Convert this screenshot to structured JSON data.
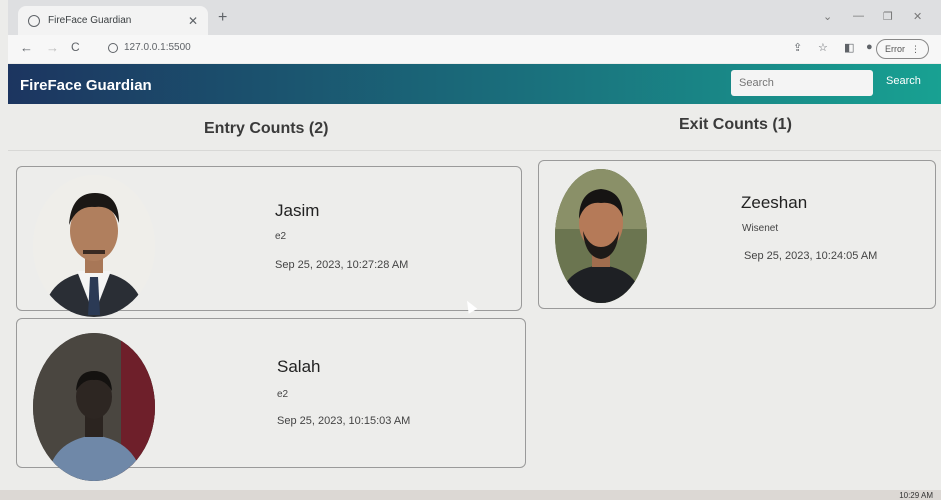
{
  "browser": {
    "tab_title": "FireFace Guardian",
    "tab_close": "✕",
    "new_tab": "+",
    "url": "127.0.0.1:5500",
    "error_label": "Error",
    "min": "⌄",
    "dash": "—",
    "restore": "❐",
    "close": "✕",
    "back": "←",
    "forward": "→",
    "reload": "C"
  },
  "header": {
    "brand": "FireFace Guardian",
    "search_placeholder": "Search",
    "search_button": "Search"
  },
  "entry": {
    "heading": "Entry Counts (2)",
    "items": [
      {
        "name": "Jasim",
        "dept": "e2",
        "time": "Sep 25, 2023, 10:27:28 AM"
      },
      {
        "name": "Salah",
        "dept": "e2",
        "time": "Sep 25, 2023, 10:15:03 AM"
      }
    ]
  },
  "exit": {
    "heading": "Exit Counts (1)",
    "items": [
      {
        "name": "Zeeshan",
        "dept": "Wisenet",
        "time": "Sep 25, 2023, 10:24:05 AM"
      }
    ]
  },
  "taskbar": {
    "clock": "10:29 AM"
  }
}
